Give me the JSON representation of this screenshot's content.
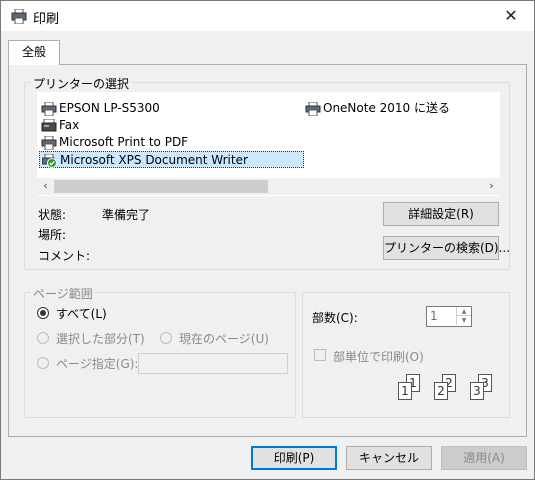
{
  "window": {
    "title": "印刷",
    "close_symbol": "✕",
    "app_icon": "printer-icon"
  },
  "tabs": [
    {
      "label": "全般",
      "selected": true
    }
  ],
  "printer_select": {
    "group_label": "プリンターの選択",
    "printers": [
      {
        "name": "EPSON LP-S5300",
        "icon": "printer-icon",
        "selected": false
      },
      {
        "name": "OneNote 2010 に送る",
        "icon": "printer-icon",
        "selected": false
      },
      {
        "name": "Fax",
        "icon": "fax-icon",
        "selected": false
      },
      {
        "name": "Microsoft Print to PDF",
        "icon": "printer-icon",
        "selected": false
      },
      {
        "name": "Microsoft XPS Document Writer",
        "icon": "default-printer-check-icon",
        "selected": true
      }
    ],
    "scroll_left": "‹",
    "scroll_right": "›",
    "status_label": "状態:",
    "status_value": "準備完了",
    "location_label": "場所:",
    "comment_label": "コメント:",
    "preferences_button": "詳細設定(R)",
    "find_printer_button": "プリンターの検索(D)..."
  },
  "page_range": {
    "group_label": "ページ範囲",
    "all_label": "すべて(L)",
    "selection_label": "選択した部分(T)",
    "current_page_label": "現在のページ(U)",
    "pages_label": "ページ指定(G):",
    "selected_option": "all"
  },
  "copies": {
    "label": "部数(C):",
    "value": "1",
    "collate_label": "部単位で印刷(O)",
    "collate_checked": false,
    "collate_pages": [
      "1",
      "1",
      "2",
      "2",
      "3",
      "3"
    ]
  },
  "footer": {
    "print_button": "印刷(P)",
    "cancel_button": "キャンセル",
    "apply_button": "適用(A)"
  },
  "colors": {
    "selection_bg": "#cce8ff",
    "default_button_border": "#0078d7",
    "check_green": "#2a9a2a"
  }
}
